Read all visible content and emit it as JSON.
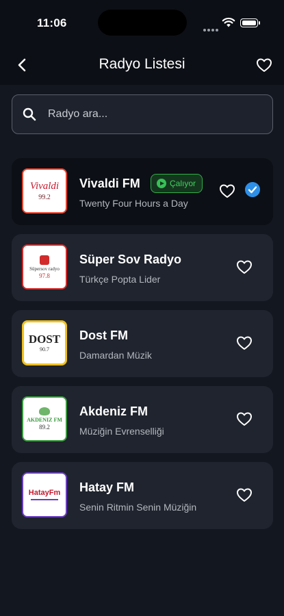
{
  "status_bar": {
    "time": "11:06"
  },
  "nav": {
    "title": "Radyo Listesi"
  },
  "search": {
    "placeholder": "Radyo ara..."
  },
  "colors": {
    "background": "#131720",
    "card": "#1f242e",
    "accent_green": "#2fb24a",
    "accent_blue": "#2d8fe8"
  },
  "stations": [
    {
      "name": "Vivaldi FM",
      "slogan": "Twenty Four Hours a Day",
      "status": "Çalıyor",
      "selected": true,
      "logo_text": "Vivaldi",
      "logo_freq": "99.2",
      "icons": [
        "heart-outline-icon",
        "check-circle-icon"
      ]
    },
    {
      "name": "Süper Sov Radyo",
      "slogan": "Türkçe Popta Lider",
      "logo_text": "Süpersov radyo",
      "logo_freq": "97.8",
      "icons": [
        "heart-outline-icon"
      ]
    },
    {
      "name": "Dost FM",
      "slogan": "Damardan Müzik",
      "logo_text": "DOST",
      "logo_freq": "90.7",
      "icons": [
        "heart-outline-icon"
      ]
    },
    {
      "name": "Akdeniz FM",
      "slogan": "Müziğin Evrenselliği",
      "logo_text": "AKDENIZ FM",
      "logo_freq": "89.2",
      "icons": [
        "heart-outline-icon"
      ]
    },
    {
      "name": "Hatay FM",
      "slogan": "Senin Ritmin Senin Müziğin",
      "logo_text": "HatayFm",
      "icons": [
        "heart-outline-icon"
      ]
    }
  ]
}
